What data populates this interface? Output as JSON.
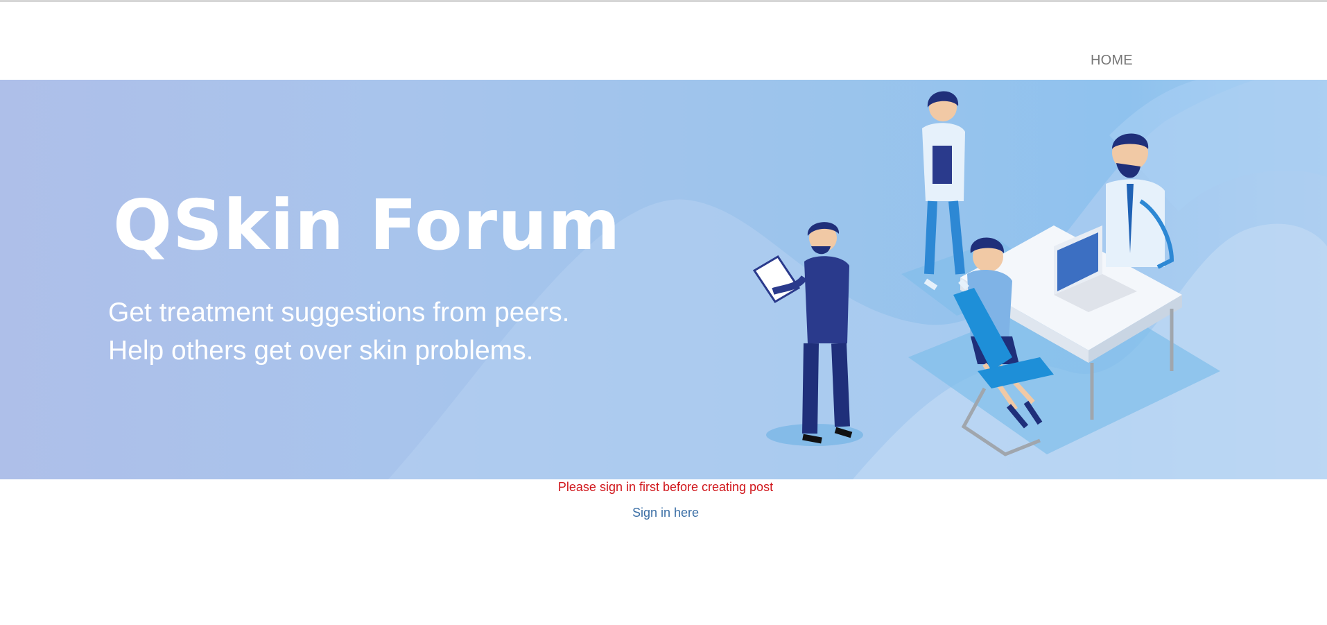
{
  "nav": {
    "home_label": "HOME"
  },
  "hero": {
    "title": "QSkin Forum",
    "tagline_line1": "Get treatment suggestions from peers.",
    "tagline_line2": "Help others get over skin problems."
  },
  "notice": {
    "message": "Please sign in first before creating post",
    "signin_link": "Sign in here"
  },
  "colors": {
    "notice_red": "#d0161b",
    "link_blue": "#3a6ea5",
    "nav_gray": "#777777",
    "hero_blue": "#9cc4ec"
  }
}
